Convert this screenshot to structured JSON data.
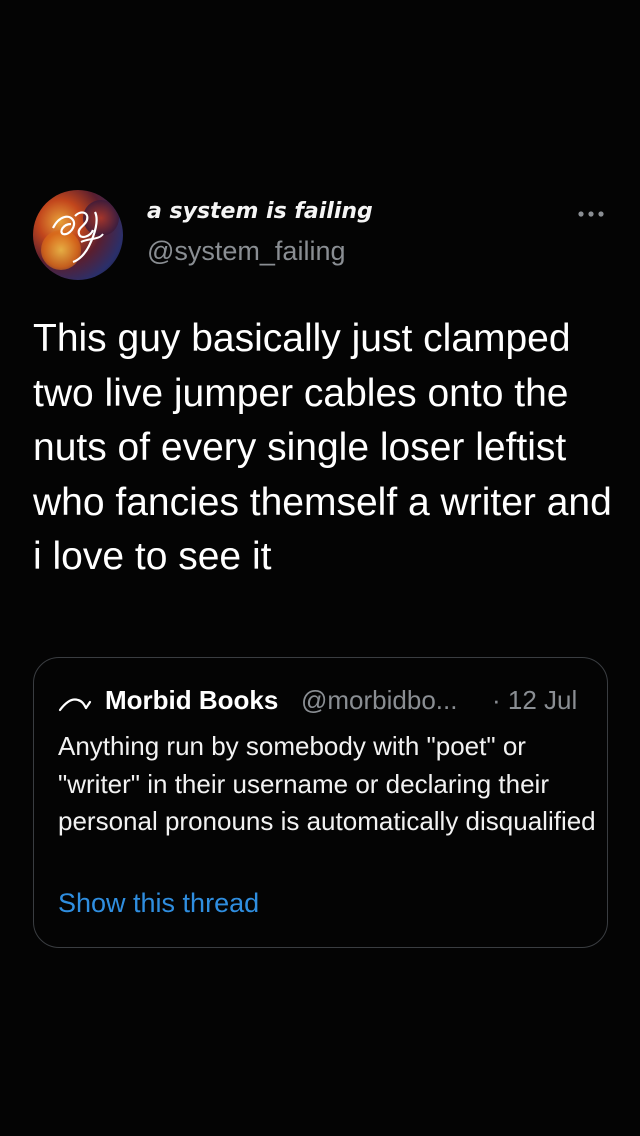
{
  "tweet": {
    "author": {
      "display_name": "a system is failing",
      "handle": "@system_failing",
      "avatar_icon": "profile-avatar"
    },
    "more_icon": "more-horizontal-icon",
    "text": "This guy basically just clamped two live jumper cables onto the nuts of every single loser leftist who fancies themself a writer and i love to see it"
  },
  "quoted_tweet": {
    "author": {
      "display_name": "Morbid Books",
      "handle": "@morbidbo...",
      "avatar_icon": "morbid-books-logo"
    },
    "date": "· 12 Jul",
    "text": "Anything run by somebody with \"poet\" or \"writer\" in their username or declaring their personal pronouns is automatically disqualified",
    "show_thread_label": "Show this thread",
    "link_color": "#2f8ee0"
  },
  "colors": {
    "background": "#040404",
    "secondary_text": "#8a8e93",
    "card_border": "#3a3d41"
  }
}
